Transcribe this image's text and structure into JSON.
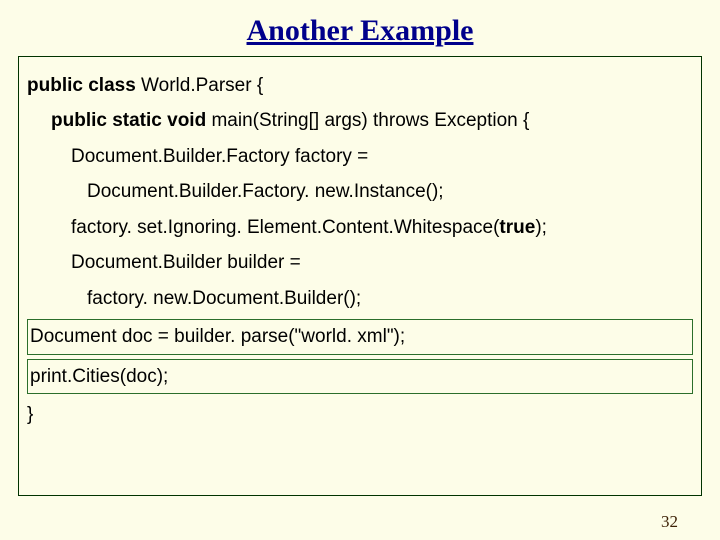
{
  "title": "Another Example",
  "code": {
    "l1": {
      "pre": "public class ",
      "rest": "World.Parser {"
    },
    "l2": {
      "pre": "public static void ",
      "rest": "main(String[] args) throws Exception {"
    },
    "l3": "Document.Builder.Factory factory =",
    "l4": "Document.Builder.Factory. new.Instance();",
    "l5_a": "factory. set.Ignoring. Element.Content.Whitespace(",
    "l5_b": "true",
    "l5_c": ");",
    "l6": "Document.Builder builder =",
    "l7": "factory. new.Document.Builder();",
    "l8": "Document doc = builder. parse(\"world. xml\");",
    "l9": "print.Cities(doc);",
    "l10": "}"
  },
  "page_number": "32"
}
